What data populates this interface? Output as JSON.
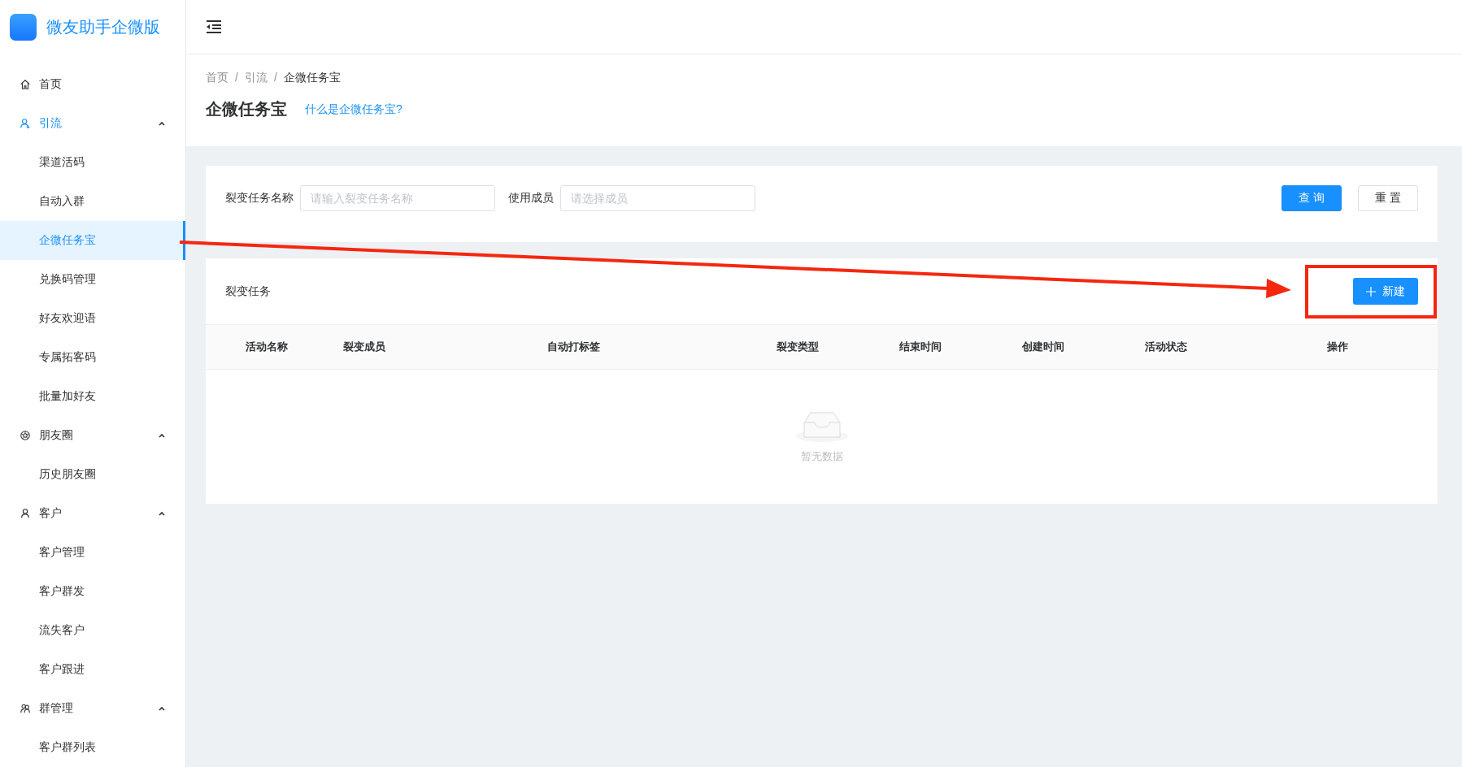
{
  "app": {
    "name": "微友助手企微版"
  },
  "sidebar": {
    "items": [
      {
        "label": "首页",
        "selected": false
      },
      {
        "label": "引流",
        "expanded": true,
        "selected": true,
        "children": [
          {
            "label": "渠道活码",
            "selected": false
          },
          {
            "label": "自动入群",
            "selected": false
          },
          {
            "label": "企微任务宝",
            "selected": true
          },
          {
            "label": "兑换码管理",
            "selected": false
          },
          {
            "label": "好友欢迎语",
            "selected": false
          },
          {
            "label": "专属拓客码",
            "selected": false
          },
          {
            "label": "批量加好友",
            "selected": false
          }
        ]
      },
      {
        "label": "朋友圈",
        "expanded": true,
        "selected": false,
        "children": [
          {
            "label": "历史朋友圈",
            "selected": false
          }
        ]
      },
      {
        "label": "客户",
        "expanded": true,
        "selected": false,
        "children": [
          {
            "label": "客户管理",
            "selected": false
          },
          {
            "label": "客户群发",
            "selected": false
          },
          {
            "label": "流失客户",
            "selected": false
          },
          {
            "label": "客户跟进",
            "selected": false
          }
        ]
      },
      {
        "label": "群管理",
        "expanded": true,
        "selected": false,
        "children": [
          {
            "label": "客户群列表",
            "selected": false
          }
        ]
      }
    ]
  },
  "breadcrumb": {
    "items": [
      "首页",
      "引流",
      "企微任务宝"
    ],
    "separator": "/"
  },
  "page_title": "企微任务宝",
  "help_link": "什么是企微任务宝?",
  "filters": [
    {
      "label": "裂变任务名称",
      "placeholder": "请输入裂变任务名称"
    },
    {
      "label": "使用成员",
      "placeholder": "请选择成员"
    }
  ],
  "filter_buttons": [
    {
      "label": "查 询",
      "kind": "primary"
    },
    {
      "label": "重 置",
      "kind": "default"
    }
  ],
  "table_card": {
    "title": "裂变任务",
    "new_button": "新建"
  },
  "table": {
    "columns": [
      "活动名称",
      "裂变成员",
      "自动打标签",
      "裂变类型",
      "结束时间",
      "创建时间",
      "活动状态",
      "操作"
    ],
    "empty_text": "暂无数据"
  },
  "annotations": {
    "arrow": true,
    "highlight_frame": true
  }
}
